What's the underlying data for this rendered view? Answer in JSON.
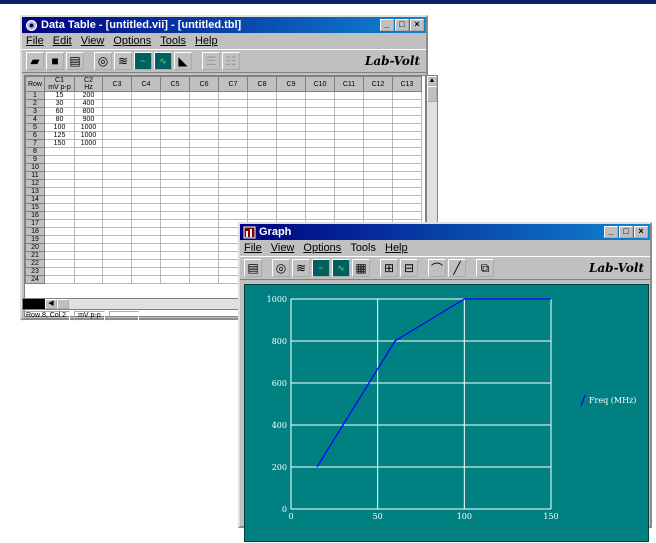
{
  "data_window": {
    "title": "Data Table - [untitled.vii] - [untitled.tbl]",
    "menu": [
      "File",
      "Edit",
      "View",
      "Options",
      "Tools",
      "Help"
    ],
    "logo": "Lab-Volt",
    "row_header": "Row",
    "columns": [
      {
        "name": "C1",
        "unit": "mV p-p"
      },
      {
        "name": "C2",
        "unit": "Hz"
      },
      {
        "name": "C3",
        "unit": ""
      },
      {
        "name": "C4",
        "unit": ""
      },
      {
        "name": "C5",
        "unit": ""
      },
      {
        "name": "C6",
        "unit": ""
      },
      {
        "name": "C7",
        "unit": ""
      },
      {
        "name": "C8",
        "unit": ""
      },
      {
        "name": "C9",
        "unit": ""
      },
      {
        "name": "C10",
        "unit": ""
      },
      {
        "name": "C11",
        "unit": ""
      },
      {
        "name": "C12",
        "unit": ""
      },
      {
        "name": "C13",
        "unit": ""
      }
    ],
    "rows": [
      [
        "15",
        "200"
      ],
      [
        "30",
        "400"
      ],
      [
        "60",
        "800"
      ],
      [
        "80",
        "900"
      ],
      [
        "100",
        "1000"
      ],
      [
        "125",
        "1000"
      ],
      [
        "150",
        "1000"
      ],
      [
        "",
        ""
      ],
      [
        "",
        ""
      ],
      [
        "",
        ""
      ],
      [
        "",
        ""
      ],
      [
        "",
        ""
      ],
      [
        "",
        ""
      ],
      [
        "",
        ""
      ],
      [
        "",
        ""
      ],
      [
        "",
        ""
      ],
      [
        "",
        ""
      ],
      [
        "",
        ""
      ],
      [
        "",
        ""
      ],
      [
        "",
        ""
      ],
      [
        "",
        ""
      ],
      [
        "",
        ""
      ],
      [
        "",
        ""
      ],
      [
        "",
        ""
      ]
    ],
    "status": {
      "cell": "Row 8, Col 2",
      "unit": "mV p-p"
    }
  },
  "graph_window": {
    "title": "Graph",
    "menu": [
      "File",
      "View",
      "Options",
      "Tools",
      "Help"
    ],
    "logo": "Lab-Volt"
  },
  "colors": {
    "titlebar": "#000080",
    "plot_bg": "#008080",
    "series": "#0000ff"
  },
  "chart_data": {
    "type": "line",
    "xlim": [
      0,
      150
    ],
    "ylim": [
      0,
      1000
    ],
    "x_ticks": [
      0,
      50,
      100,
      150
    ],
    "y_ticks": [
      0,
      200,
      400,
      600,
      800,
      1000
    ],
    "grid": true,
    "legend_position": "right",
    "series": [
      {
        "name": "Freq (MHz)",
        "x": [
          15,
          30,
          60,
          80,
          100,
          125,
          150
        ],
        "y": [
          200,
          400,
          800,
          900,
          1000,
          1000,
          1000
        ]
      }
    ]
  }
}
